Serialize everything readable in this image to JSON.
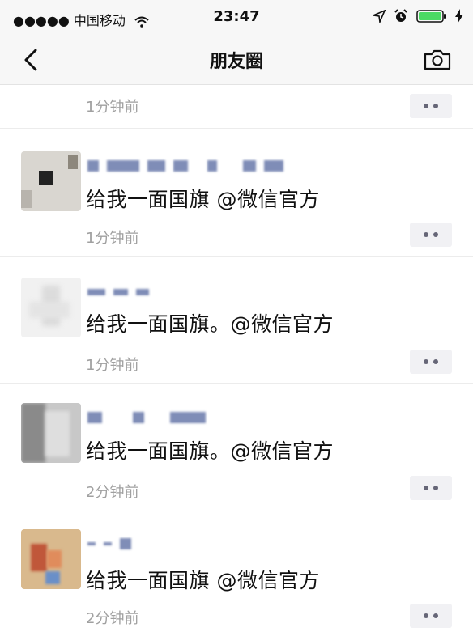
{
  "status_bar": {
    "signal_dots": "●●●●●",
    "carrier": "中国移动",
    "time": "23:47",
    "icons": [
      "wifi-icon",
      "location-arrow-icon",
      "alarm-icon",
      "battery-icon",
      "charging-icon"
    ]
  },
  "nav": {
    "title": "朋友圈",
    "back_icon": "chevron-left-icon",
    "camera_icon": "camera-icon"
  },
  "posts": [
    {
      "content": "",
      "time_ago": "1分钟前"
    },
    {
      "content": "给我一面国旗 @微信官方",
      "time_ago": "1分钟前"
    },
    {
      "content": "给我一面国旗。@微信官方",
      "time_ago": "1分钟前"
    },
    {
      "content": "给我一面国旗。@微信官方",
      "time_ago": "2分钟前"
    },
    {
      "content": "给我一面国旗 @微信官方",
      "time_ago": "2分钟前"
    }
  ],
  "colors": {
    "name_link": "#7f8db7",
    "time_gray": "#a0a0a0",
    "bar_bg": "#f7f7f7"
  }
}
